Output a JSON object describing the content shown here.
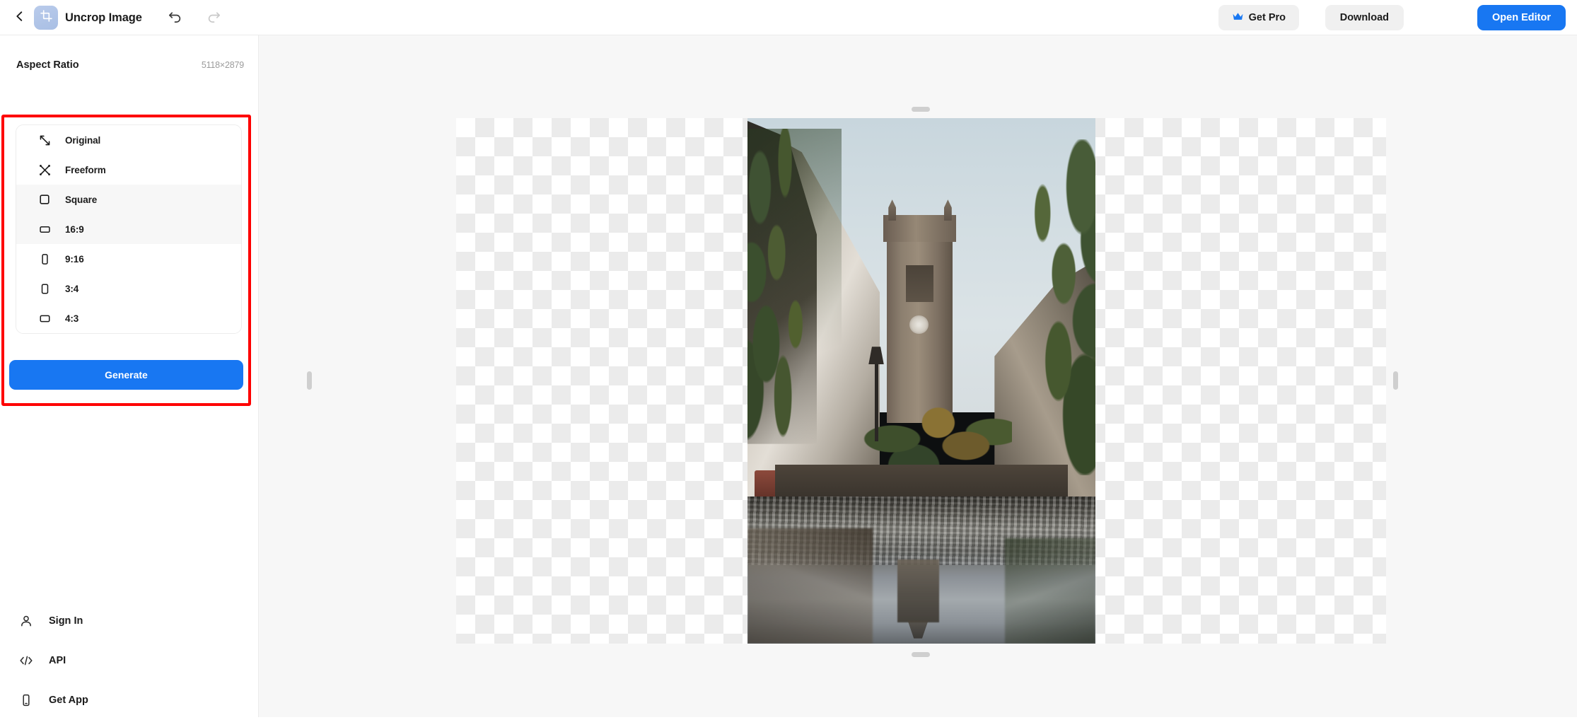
{
  "topbar": {
    "back_icon": "chevron-left-icon",
    "app_icon": "crop-icon",
    "title": "Uncrop Image",
    "undo_icon": "undo-arrow-icon",
    "redo_icon": "redo-arrow-icon",
    "get_pro_label": "Get Pro",
    "get_pro_icon": "crown-icon",
    "download_label": "Download",
    "open_editor_label": "Open Editor",
    "accent_color": "#1877f2"
  },
  "sidebar": {
    "section_title": "Aspect Ratio",
    "image_dimensions": "5118×2879",
    "highlight_color": "#fe0000",
    "ratios": [
      {
        "label": "Original",
        "icon": "diagonal-arrows-icon",
        "shaded": false
      },
      {
        "label": "Freeform",
        "icon": "freeform-arrows-icon",
        "shaded": false
      },
      {
        "label": "Square",
        "icon": "square-icon",
        "shaded": true
      },
      {
        "label": "16:9",
        "icon": "landscape-rect-icon",
        "shaded": true
      },
      {
        "label": "9:16",
        "icon": "portrait-rect-icon",
        "shaded": false
      },
      {
        "label": "3:4",
        "icon": "portrait-rect-icon",
        "shaded": false
      },
      {
        "label": "4:3",
        "icon": "landscape-rect-icon",
        "shaded": false
      }
    ],
    "generate_label": "Generate",
    "nav": [
      {
        "label": "Sign In",
        "icon": "user-icon"
      },
      {
        "label": "API",
        "icon": "code-brackets-icon"
      },
      {
        "label": "Get App",
        "icon": "mobile-phone-icon"
      }
    ]
  },
  "canvas": {
    "transparent_pattern": "checkerboard",
    "photo_description": "European cobblestone street with church clock tower and puddle reflection",
    "handles": [
      "top-handle",
      "bottom-handle",
      "left-handle",
      "right-handle"
    ]
  }
}
